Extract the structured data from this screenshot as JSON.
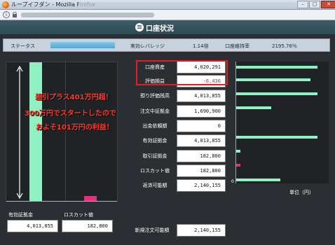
{
  "window": {
    "title": "ループイフダン - Mozilla Firefox"
  },
  "header": {
    "title": "口座状況"
  },
  "status": {
    "status_label": "ステータス",
    "leverage_label": "実効レバレッジ",
    "leverage_value": "1.14倍",
    "maintenance_label": "口座維持率",
    "maintenance_value": "2195.76％",
    "status_level": 0.95
  },
  "left_panel": {
    "labels": [
      "有効証拠金",
      "ロスカット値"
    ],
    "values": [
      "4,013,855",
      "182,800"
    ],
    "colors": {
      "margin": "#8ff0c1",
      "losscut": "#e0307a"
    }
  },
  "account": {
    "rows": [
      {
        "label": "口座資産",
        "value": "4,020,291"
      },
      {
        "label": "評価損益",
        "value": "-6,436"
      },
      {
        "label": "預り評価残高",
        "value": "4,013,855"
      },
      {
        "label": "注文中証拠金",
        "value": "1,690,900"
      },
      {
        "label": "出金依頼額",
        "value": "0"
      },
      {
        "label": "有効証拠金",
        "value": "4,013,855"
      },
      {
        "label": "取引証拠金",
        "value": "182,800"
      },
      {
        "label": "ロスカット値",
        "value": "182,800"
      },
      {
        "label": "返済可能額",
        "value": "2,140,155"
      }
    ],
    "new_order": {
      "label": "新規注文可能額",
      "value": "2,140,155"
    },
    "negative_color": "#d0203a"
  },
  "right_chart": {
    "zero_label": "0",
    "unit_label": "単位（円）",
    "bars": [
      1.0,
      0.91,
      1.0,
      0.43,
      0.0,
      1.0,
      0.05,
      0.05,
      0.54
    ],
    "bar_colors": [
      "#8ff0c1",
      "#8ff0c1",
      "#8ff0c1",
      "#8ff0c1",
      "#8ff0c1",
      "#8ff0c1",
      "#8ff0c1",
      "#e0307a",
      "#8ff0c1"
    ]
  },
  "annotation": {
    "line1": "差引プラス401万円超！",
    "line2": "300万円でスタートしたので",
    "line3": "およそ101万円の利益！"
  }
}
